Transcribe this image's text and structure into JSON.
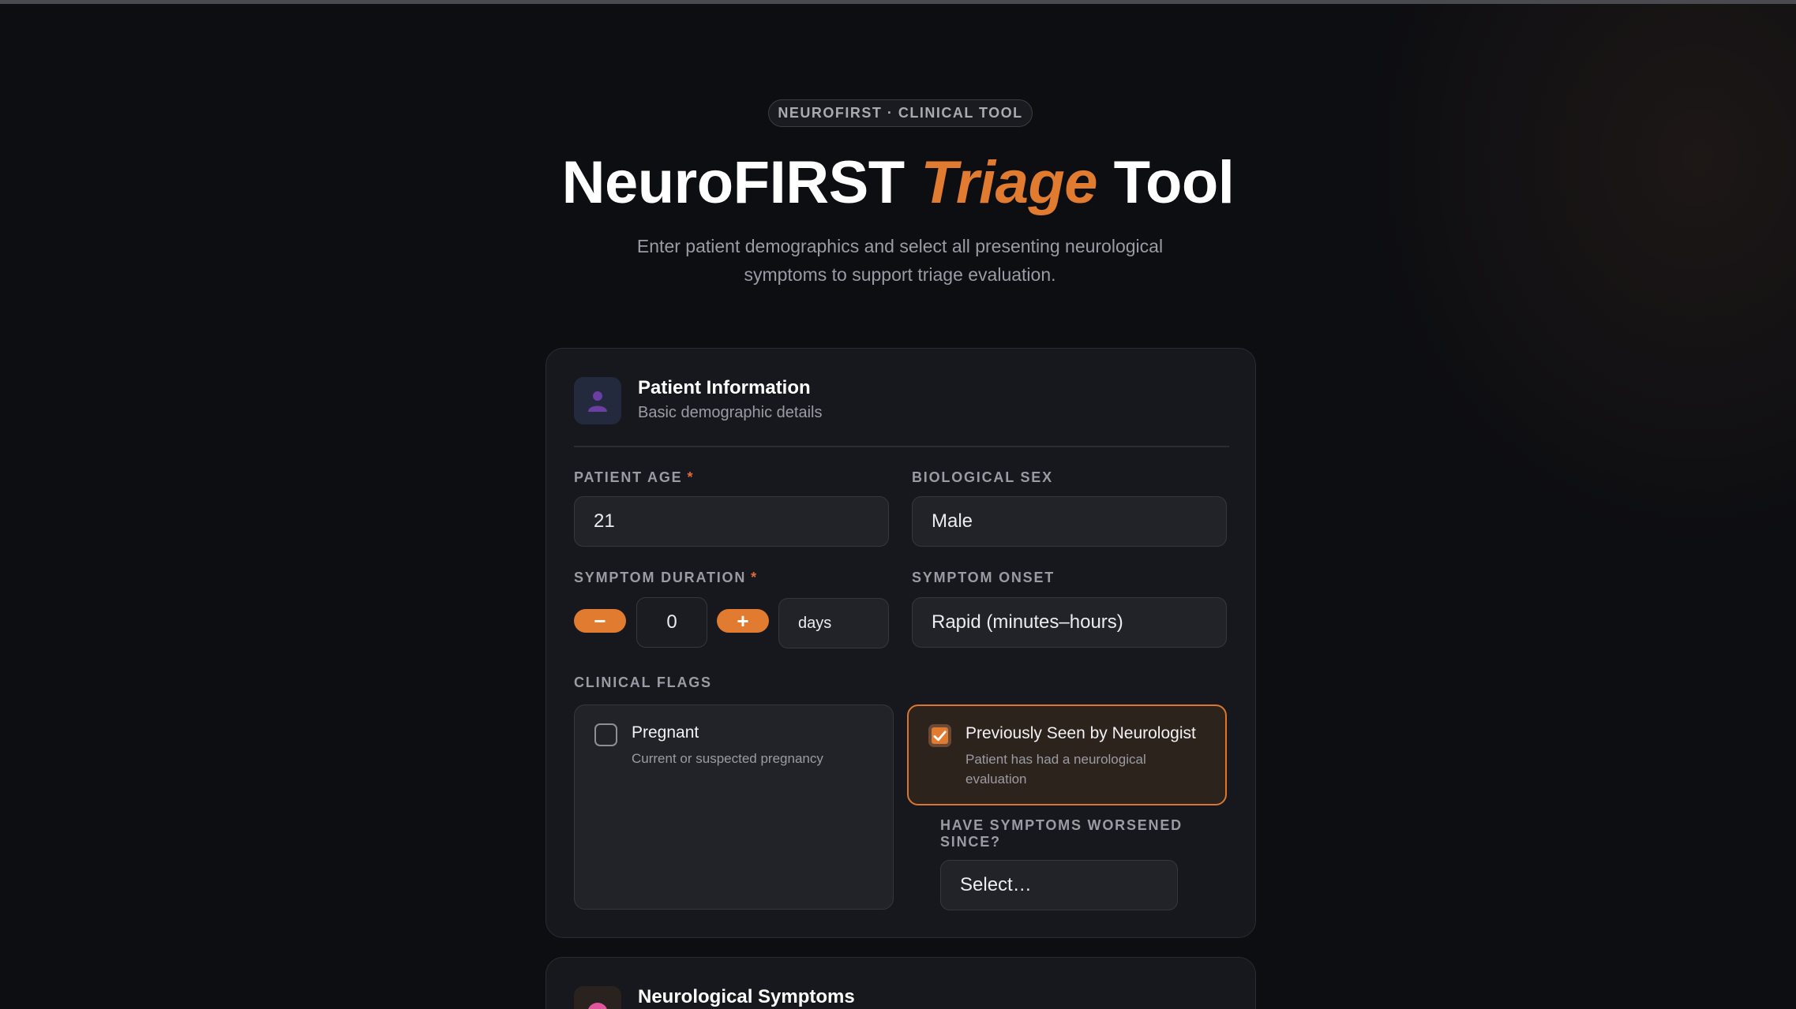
{
  "header": {
    "eyebrow": "NEUROFIRST · CLINICAL TOOL",
    "title_part1": "NeuroFIRST",
    "title_accent": "Triage",
    "title_part2": "Tool",
    "subtitle": "Enter patient demographics and select all presenting neurological symptoms to support triage evaluation."
  },
  "patient_section": {
    "icon": "person-icon",
    "title": "Patient Information",
    "subtitle": "Basic demographic details",
    "age_label": "PATIENT AGE",
    "required_mark": "*",
    "age_value": "21",
    "sex_label": "BIOLOGICAL SEX",
    "sex_value": "Male",
    "duration_label": "SYMPTOM DURATION",
    "duration_decrement": "−",
    "duration_value": "0",
    "duration_increment": "+",
    "duration_unit": "days",
    "onset_label": "SYMPTOM ONSET",
    "onset_value": "Rapid (minutes–hours)",
    "flags_label": "CLINICAL FLAGS",
    "flags": [
      {
        "title": "Pregnant",
        "desc": "Current or suspected pregnancy",
        "checked": false
      },
      {
        "title": "Previously Seen by Neurologist",
        "desc": "Patient has had a neurological evaluation",
        "checked": true
      }
    ],
    "worsened_label": "HAVE SYMPTOMS WORSENED SINCE?",
    "worsened_value": "Select…"
  },
  "symptoms_section": {
    "icon": "brain-icon",
    "title": "Neurological Symptoms"
  },
  "colors": {
    "accent": "#e07b30",
    "background": "#0d0e12",
    "card": "#17181d"
  }
}
